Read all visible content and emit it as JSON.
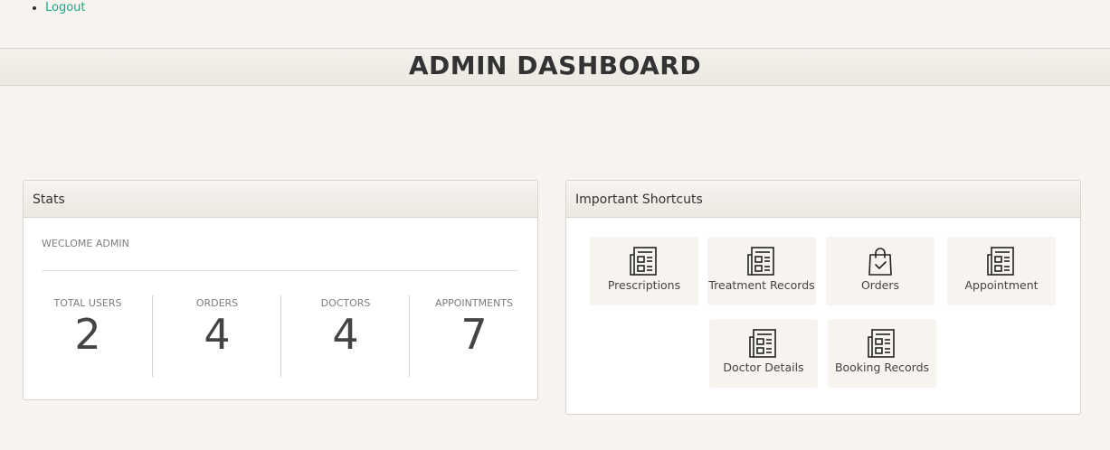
{
  "nav": {
    "logout_label": "Logout"
  },
  "header": {
    "title": "ADMIN DASHBOARD"
  },
  "stats_panel": {
    "title": "Stats",
    "welcome": "WECLOME ADMIN",
    "items": [
      {
        "label": "TOTAL USERS",
        "value": "2"
      },
      {
        "label": "ORDERS",
        "value": "4"
      },
      {
        "label": "DOCTORS",
        "value": "4"
      },
      {
        "label": "APPOINTMENTS",
        "value": "7"
      }
    ]
  },
  "shortcuts_panel": {
    "title": "Important Shortcuts",
    "items": [
      {
        "label": "Prescriptions",
        "icon": "newspaper-icon"
      },
      {
        "label": "Treatment Records",
        "icon": "newspaper-icon"
      },
      {
        "label": "Orders",
        "icon": "shopping-bag-icon"
      },
      {
        "label": "Appointment",
        "icon": "newspaper-icon"
      },
      {
        "label": "Doctor Details",
        "icon": "newspaper-icon"
      },
      {
        "label": "Booking Records",
        "icon": "newspaper-icon"
      }
    ]
  },
  "colors": {
    "link": "#1aa889",
    "background": "#f7f4ef",
    "panel_border": "#d9d5cf"
  }
}
